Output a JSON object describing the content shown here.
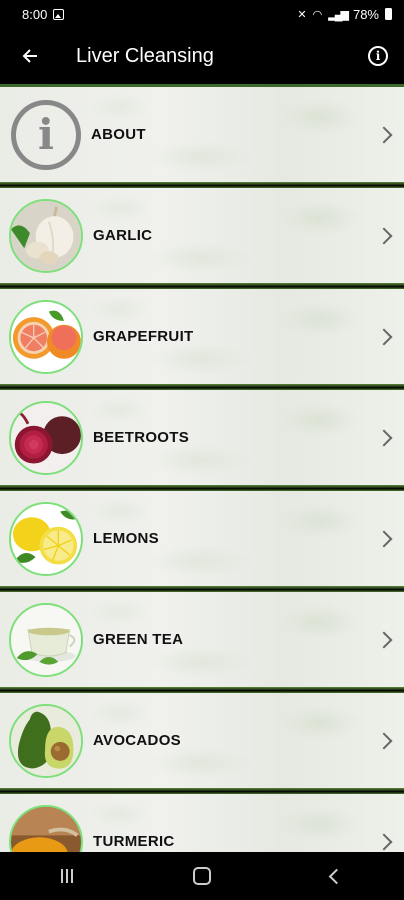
{
  "status_bar": {
    "time": "8:00",
    "battery": "78%"
  },
  "app_bar": {
    "title": "Liver Cleansing",
    "back_icon": "arrow-left-icon",
    "info_icon": "info-circle-icon"
  },
  "list": {
    "items": [
      {
        "label": "ABOUT",
        "icon": "info-icon"
      },
      {
        "label": "GARLIC",
        "icon": "garlic-icon"
      },
      {
        "label": "GRAPEFRUIT",
        "icon": "grapefruit-icon"
      },
      {
        "label": "BEETROOTS",
        "icon": "beetroot-icon"
      },
      {
        "label": "LEMONS",
        "icon": "lemon-icon"
      },
      {
        "label": "GREEN TEA",
        "icon": "green-tea-icon"
      },
      {
        "label": "AVOCADOS",
        "icon": "avocado-icon"
      },
      {
        "label": "TURMERIC",
        "icon": "turmeric-icon"
      }
    ],
    "about_glyph": "i"
  },
  "colors": {
    "thumb_border": "#7ee07a",
    "divider_green": "#5c8a3a"
  },
  "nav_bar": {
    "buttons": [
      "recents-icon",
      "home-icon",
      "back-icon"
    ]
  }
}
